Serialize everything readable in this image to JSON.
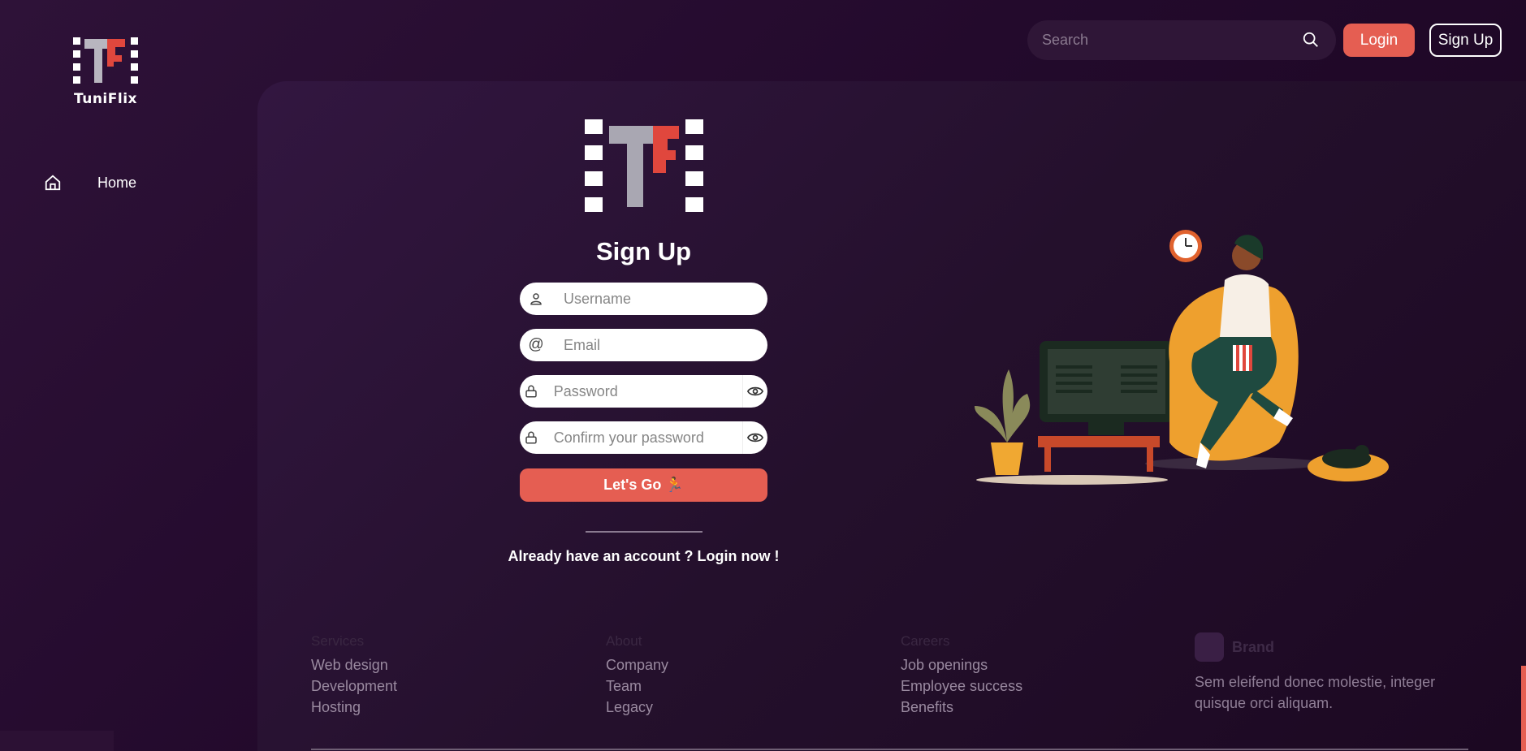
{
  "app": {
    "brand_name": "TuniFlix"
  },
  "sidebar": {
    "items": [
      {
        "label": "Home",
        "icon": "home-icon"
      }
    ]
  },
  "header": {
    "search": {
      "placeholder": "Search",
      "icon": "search-icon"
    },
    "login_label": "Login",
    "signup_label": "Sign Up"
  },
  "form": {
    "title": "Sign Up",
    "username": {
      "placeholder": "Username",
      "icon": "user-icon"
    },
    "email": {
      "placeholder": "Email",
      "icon": "at-icon"
    },
    "password": {
      "placeholder": "Password",
      "icon": "lock-icon"
    },
    "confirm": {
      "placeholder": "Confirm your password",
      "icon": "lock-icon"
    },
    "submit_label": "Let's Go 🏃",
    "login_prompt": "Already have an account ? Login now !"
  },
  "footer": {
    "columns": [
      {
        "heading": "Services",
        "links": [
          "Web design",
          "Development",
          "Hosting"
        ]
      },
      {
        "heading": "About",
        "links": [
          "Company",
          "Team",
          "Legacy"
        ]
      },
      {
        "heading": "Careers",
        "links": [
          "Job openings",
          "Employee success",
          "Benefits"
        ]
      }
    ],
    "brand": {
      "name": "Brand",
      "description": "Sem eleifend donec molestie, integer quisque orci aliquam."
    }
  },
  "colors": {
    "accent": "#e55e52",
    "background": "#230a2c",
    "card": "#2a1233"
  }
}
